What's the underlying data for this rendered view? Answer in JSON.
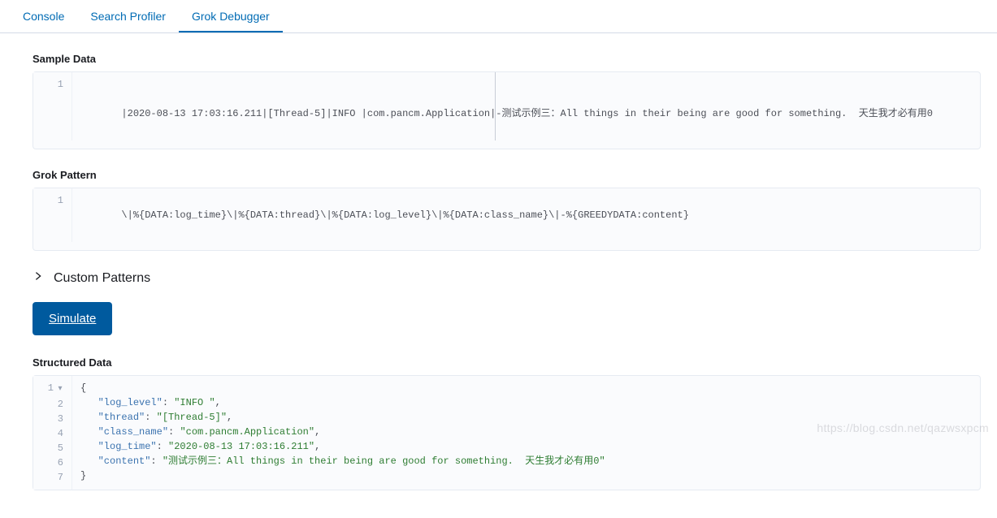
{
  "tabs": {
    "console": "Console",
    "search_profiler": "Search Profiler",
    "grok_debugger": "Grok Debugger",
    "active": "grok_debugger"
  },
  "sections": {
    "sample_data_label": "Sample Data",
    "grok_pattern_label": "Grok Pattern",
    "custom_patterns_label": "Custom Patterns",
    "structured_data_label": "Structured Data"
  },
  "sample_data": {
    "line_number": "1",
    "content": " |2020-08-13 17:03:16.211|[Thread-5]|INFO |com.pancm.Application|-测试示例三：All things in their being are good for something.  天生我才必有用0"
  },
  "grok_pattern": {
    "line_number": "1",
    "content": " \\|%{DATA:log_time}\\|%{DATA:thread}\\|%{DATA:log_level}\\|%{DATA:class_name}\\|-%{GREEDYDATA:content}"
  },
  "simulate_button": "Simulate",
  "structured_data": {
    "gutter": {
      "l1": "1",
      "l2": "2",
      "l3": "3",
      "l4": "4",
      "l5": "5",
      "l6": "6",
      "l7": "7"
    },
    "brace_open": "{",
    "brace_close": "}",
    "kv": {
      "log_level_k": "\"log_level\"",
      "log_level_v": "\"INFO \"",
      "thread_k": "\"thread\"",
      "thread_v": "\"[Thread-5]\"",
      "class_name_k": "\"class_name\"",
      "class_name_v": "\"com.pancm.Application\"",
      "log_time_k": "\"log_time\"",
      "log_time_v": "\"2020-08-13 17:03:16.211\"",
      "content_k": "\"content\"",
      "content_v": "\"测试示例三：All things in their being are good for something.  天生我才必有用0\""
    },
    "colon": ": ",
    "comma": ",",
    "indent": "   "
  },
  "watermark": "https://blog.csdn.net/qazwsxpcm"
}
